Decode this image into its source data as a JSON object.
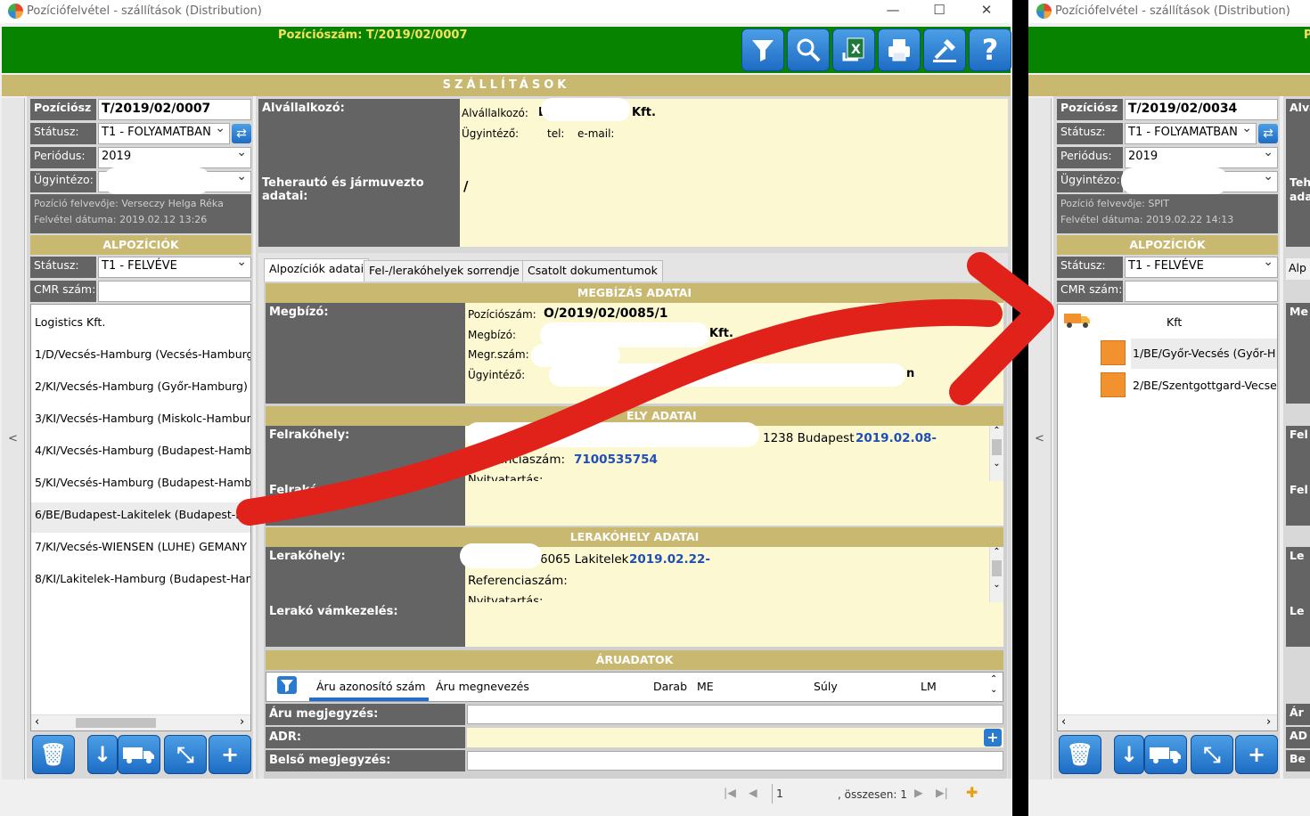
{
  "left_window": {
    "title": "Pozíciófelvétel - szállítások (Distribution)",
    "controls": {
      "minimize": "—",
      "maximize": "☐",
      "close": "✕"
    },
    "position_number_header": "Pozíciószám: T/2019/02/0007",
    "toolbar": [
      "filter-icon",
      "search-icon",
      "excel-icon",
      "print-icon",
      "stamp-icon",
      "help-icon"
    ],
    "band_title": "SZÁLLÍTÁSOK",
    "side_arrow": "<",
    "form": {
      "poz_label": "Pozíciósz",
      "poz_value": "T/2019/02/0007",
      "status_label": "Státusz:",
      "status_value": "T1 - FOLYAMATBAN",
      "period_label": "Periódus:",
      "period_value": "2019",
      "agent_label": "Ügyintézo:",
      "recorder_line": "Pozíció felvevője:   Verseczy Helga Réka",
      "date_line": "Felvétel dátuma:   2019.02.12 13:26"
    },
    "subpositions": {
      "title": "ALPOZÍCIÓK",
      "status_label": "Státusz:",
      "status_value": "T1 - FELVÉVE",
      "cmr_label": "CMR szám:",
      "items": [
        "Logistics Kft.",
        "1/D/Vecsés-Hamburg (Vecsés-Hamburg",
        "2/KI/Vecsés-Hamburg (Győr-Hamburg)",
        "3/KI/Vecsés-Hamburg (Miskolc-Hamburg",
        "4/KI/Vecsés-Hamburg (Budapest-Hamb",
        "5/KI/Vecsés-Hamburg (Budapest-Hamb",
        "6/BE/Budapest-Lakitelek (Budapest-Ha",
        "7/KI/Vecsés-WIENSEN (LUHE) GEMANY",
        "8/KI/Lakitelek-Hamburg (Budapest-Ham"
      ]
    },
    "subcontractor": {
      "label": "Alvállalkozó:",
      "company_label": "Alvállalkozó:",
      "company_visible_start": "L",
      "company_suffix": "Kft.",
      "agent_label": "Ügyintéző:",
      "tel_label": "tel:",
      "email_label": "e-mail:"
    },
    "truck": {
      "label": "Teherautó és jármuvezto adatai:",
      "value": "/"
    },
    "tabs": [
      "Alpozíciók adatai",
      "Fel-/lerakóhelyek sorrendje",
      "Csatolt dokumentumok"
    ],
    "order": {
      "title": "MEGBÍZÁS ADATAI",
      "label": "Megbízó:",
      "pos_label": "Pozíciószám:",
      "pos_value": "O/2019/02/0085/1",
      "client_label": "Megbízó:",
      "client_suffix": "Kft.",
      "ref_label": "Megr.szám:",
      "agent_label": "Ügyintéző:",
      "agent_tail": "n"
    },
    "loading": {
      "title": "FELRAKÓHELY ADATAI",
      "title_visible": "ELY ADATAI",
      "label": "Felrakóhely:",
      "address": "1238 Budapest",
      "date": "2019.02.08-",
      "ref_label": "Referenciaszám:",
      "ref_label_visible": "eferenciaszám:",
      "ref_value": "7100535754",
      "hours": "Nyitvatartás:",
      "customs_label": "Felrakó vá"
    },
    "unloading": {
      "title": "LERAKÓHELY ADATAI",
      "label": "Lerakóhely:",
      "address": "6065 Lakitelek",
      "date": "2019.02.22-",
      "ref_label": "Referenciaszám:",
      "hours": "Nyitvatartás:",
      "customs_label": "Lerakó vámkezelés:"
    },
    "goods": {
      "title": "ÁRUADATOK",
      "columns": [
        "Áru azonosító szám",
        "Áru megnevezés",
        "Darab",
        "ME",
        "Súly",
        "LM"
      ],
      "note_label": "Áru megjegyzés:",
      "adr_label": "ADR:",
      "internal_label": "Belső megjegyzés:"
    },
    "pager": {
      "page": "1",
      "total": ", összesen: 1"
    }
  },
  "right_window": {
    "title": "Pozíciófelvétel - szállítások (Distribution)",
    "header_fragment": "P",
    "side_arrow": "<",
    "form": {
      "poz_label": "Pozíciósz",
      "poz_value": "T/2019/02/0034",
      "status_label": "Státusz:",
      "status_value": "T1 - FOLYAMATBAN",
      "period_label": "Periódus:",
      "period_value": "2019",
      "agent_label": "Ügyintézo:",
      "recorder_line": "Pozíció felvevője:   SPIT",
      "date_line": "Felvétel dátuma:   2019.02.22 14:13"
    },
    "subpositions": {
      "title": "ALPOZÍCIÓK",
      "status_label": "Státusz:",
      "status_value": "T1 - FELVÉVE",
      "cmr_label": "CMR szám:",
      "root": "Kft",
      "items": [
        "1/BE/Győr-Vecsés (Győr-H",
        "2/BE/Szentgottgard-Vecse"
      ]
    },
    "right_fragments": [
      "Alvá",
      "Teh",
      "ada",
      "Alp",
      "Me",
      "Fel",
      "Fel",
      "Le",
      "Le",
      "Ár",
      "AD",
      "Be"
    ]
  },
  "colors": {
    "header_green": "#078300",
    "band": "#c8b870",
    "label_grey": "#646464",
    "annotation_red": "#e0221b"
  }
}
